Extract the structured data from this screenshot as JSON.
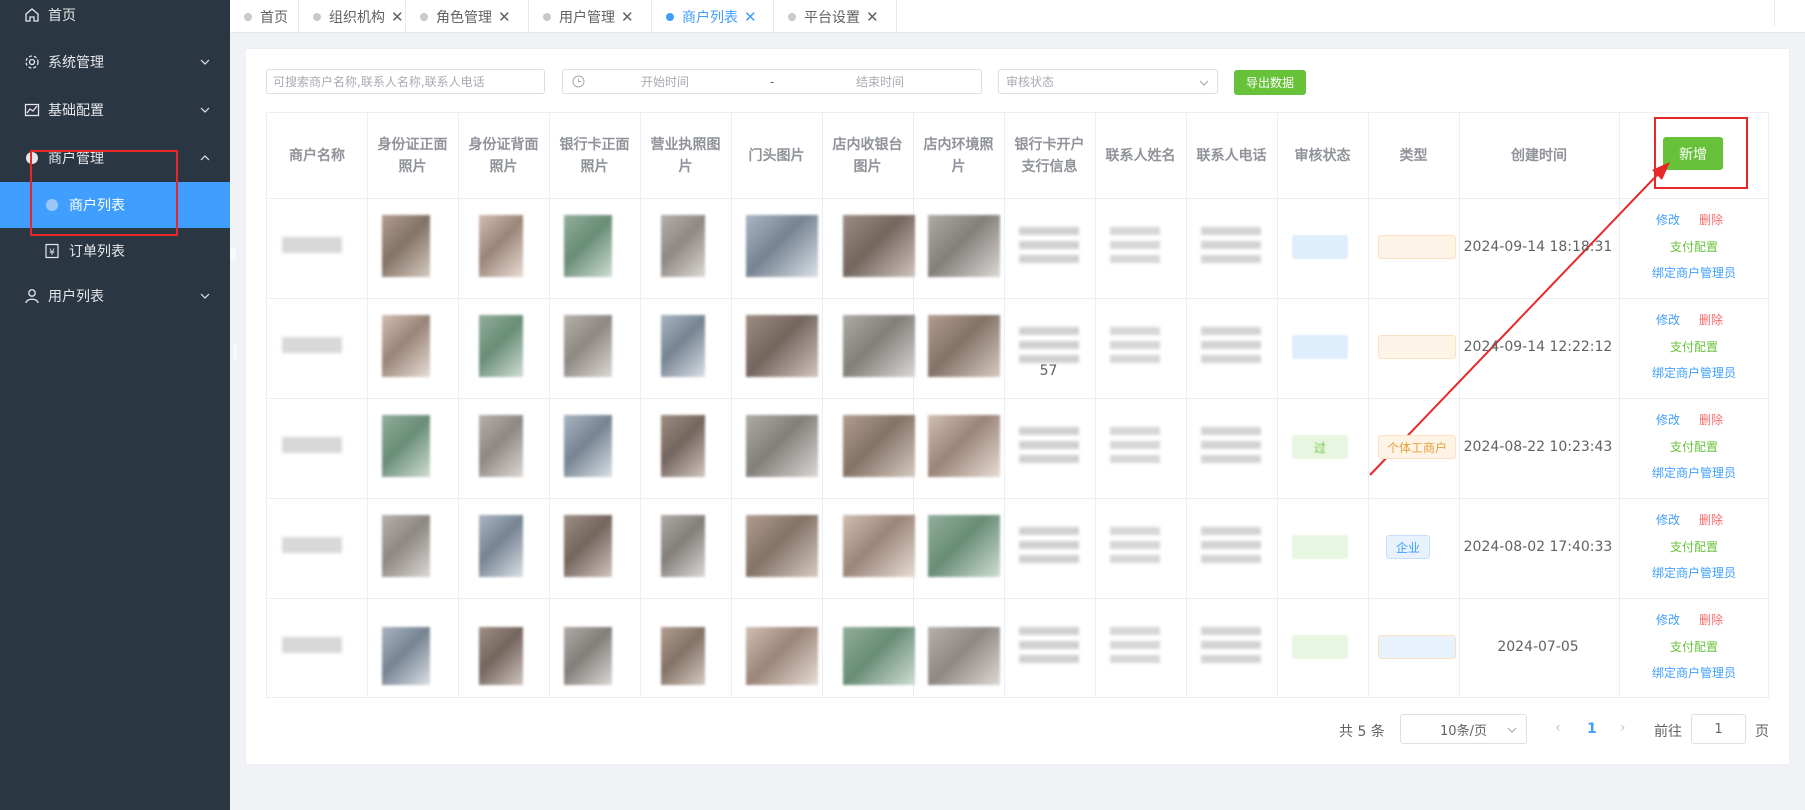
{
  "sidebar": {
    "items": [
      {
        "label": "首页",
        "icon": "home-icon"
      },
      {
        "label": "系统管理",
        "icon": "gear-icon"
      },
      {
        "label": "基础配置",
        "icon": "chart-icon"
      },
      {
        "label": "商户管理",
        "icon": "gear-icon"
      },
      {
        "label": "商户列表",
        "icon": "gear-icon"
      },
      {
        "label": "订单列表",
        "icon": "yen-icon"
      },
      {
        "label": "用户列表",
        "icon": "user-icon"
      }
    ]
  },
  "tabs": [
    {
      "label": "首页"
    },
    {
      "label": "组织机构"
    },
    {
      "label": "角色管理"
    },
    {
      "label": "用户管理"
    },
    {
      "label": "商户列表"
    },
    {
      "label": "平台设置"
    }
  ],
  "toolbar": {
    "search_placeholder": "可搜索商户名称,联系人名称,联系人电话",
    "start_placeholder": "开始时间",
    "range_sep": "-",
    "end_placeholder": "结束时间",
    "status_placeholder": "审核状态",
    "export_label": "导出数据"
  },
  "table": {
    "headers": [
      "商户名称",
      "身份证正面照片",
      "身份证背面照片",
      "银行卡正面照片",
      "营业执照图片",
      "门头图片",
      "店内收银台图片",
      "店内环境照片",
      "银行卡开户支行信息",
      "联系人姓名",
      "联系人电话",
      "审核状态",
      "类型",
      "创建时间"
    ],
    "add_label": "新增",
    "rows": [
      {
        "created": "2024-09-14 18:18:31",
        "type": "",
        "status": "",
        "extra": ""
      },
      {
        "created": "2024-09-14 12:22:12",
        "type": "",
        "status": "",
        "extra": "57"
      },
      {
        "created": "2024-08-22 10:23:43",
        "type": "个体工商户",
        "status": "过",
        "extra": ""
      },
      {
        "created": "2024-08-02 17:40:33",
        "type": "企业",
        "status": "",
        "extra": ""
      },
      {
        "created": "2024-07-05",
        "type": "",
        "status": "",
        "extra": ""
      }
    ],
    "ops": {
      "edit": "修改",
      "delete": "删除",
      "pay": "支付配置",
      "bind": "绑定商户管理员"
    }
  },
  "pagination": {
    "total": "共 5 条",
    "size": "10条/页",
    "current": "1",
    "goto": "前往",
    "page_input": "1",
    "page_unit": "页"
  }
}
